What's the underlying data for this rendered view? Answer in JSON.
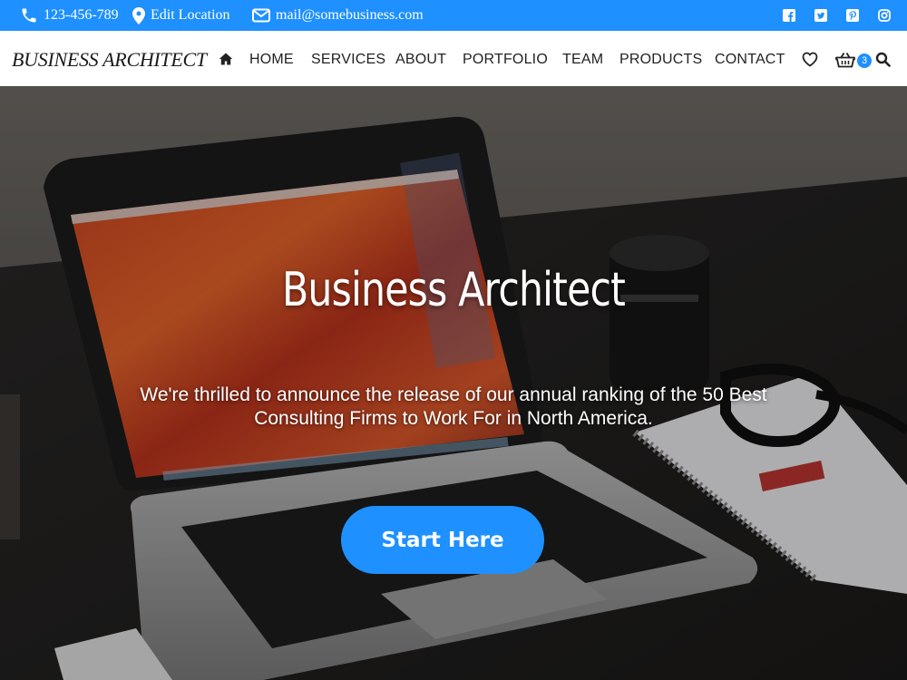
{
  "topbar": {
    "phone": "123-456-789",
    "location": "Edit Location",
    "email": "mail@somebusiness.com",
    "socials": [
      "facebook-icon",
      "twitter-icon",
      "pinterest-icon",
      "instagram-icon"
    ]
  },
  "header": {
    "logo": "BUSINESS ARCHITECT",
    "nav": [
      "HOME",
      "SERVICES",
      "ABOUT",
      "PORTFOLIO",
      "TEAM",
      "PRODUCTS",
      "CONTACT"
    ],
    "cart_count": "3"
  },
  "hero": {
    "title": "Business Architect",
    "subtitle": "We're thrilled to announce the release of our annual ranking of the 50 Best Consulting Firms to Work For in North America.",
    "cta_label": "Start Here"
  },
  "colors": {
    "accent": "#1e90ff",
    "header_bg": "#ffffff",
    "text_dark": "#222222"
  }
}
